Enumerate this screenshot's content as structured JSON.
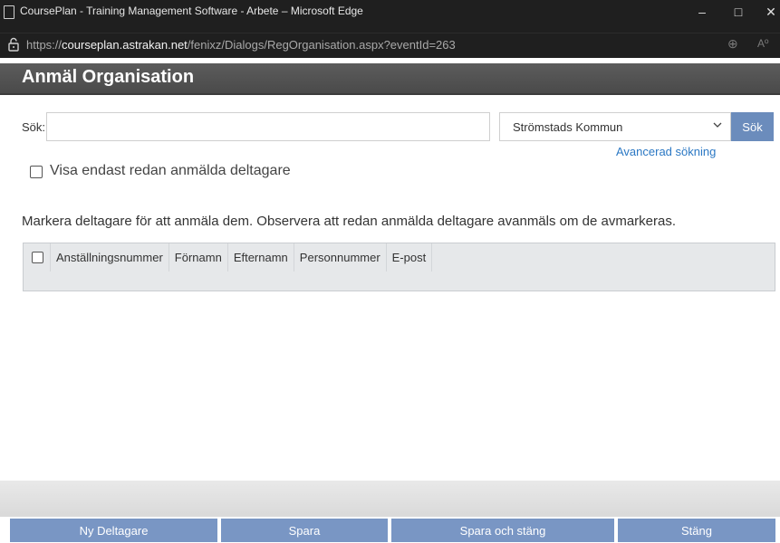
{
  "window": {
    "title": "CoursePlan - Training Management Software - Arbete – Microsoft Edge",
    "minimize": "–",
    "maximize": "□",
    "close": "✕"
  },
  "address": {
    "url_prefix": "https://",
    "url_host": "courseplan.astrakan.net",
    "url_path": "/fenixz/Dialogs/RegOrganisation.aspx?eventId=263",
    "zoom_icon": "⊕",
    "read_aloud": "Aº"
  },
  "page": {
    "title": "Anmäl Organisation"
  },
  "search": {
    "label": "Sök:",
    "value": "",
    "placeholder": "",
    "organisation_selected": "Strömstads Kommun",
    "button_label": "Sök",
    "advanced_link": "Avancerad sökning"
  },
  "filter": {
    "show_registered_label": "Visa endast redan anmälda deltagare",
    "checked": false
  },
  "instruction": "Markera deltagare för att anmäla dem. Observera att redan anmälda deltagare avanmäls om de avmarkeras.",
  "table": {
    "columns": [
      "Anställningsnummer",
      "Förnamn",
      "Efternamn",
      "Personnummer",
      "E-post"
    ],
    "rows": []
  },
  "footer": {
    "new_participant": "Ny Deltagare",
    "save": "Spara",
    "save_close": "Spara och stäng",
    "close": "Stäng"
  },
  "colors": {
    "titlebar": "#1f1f1f",
    "header": "#525252",
    "button": "#7996c4",
    "link": "#2b78c4"
  }
}
